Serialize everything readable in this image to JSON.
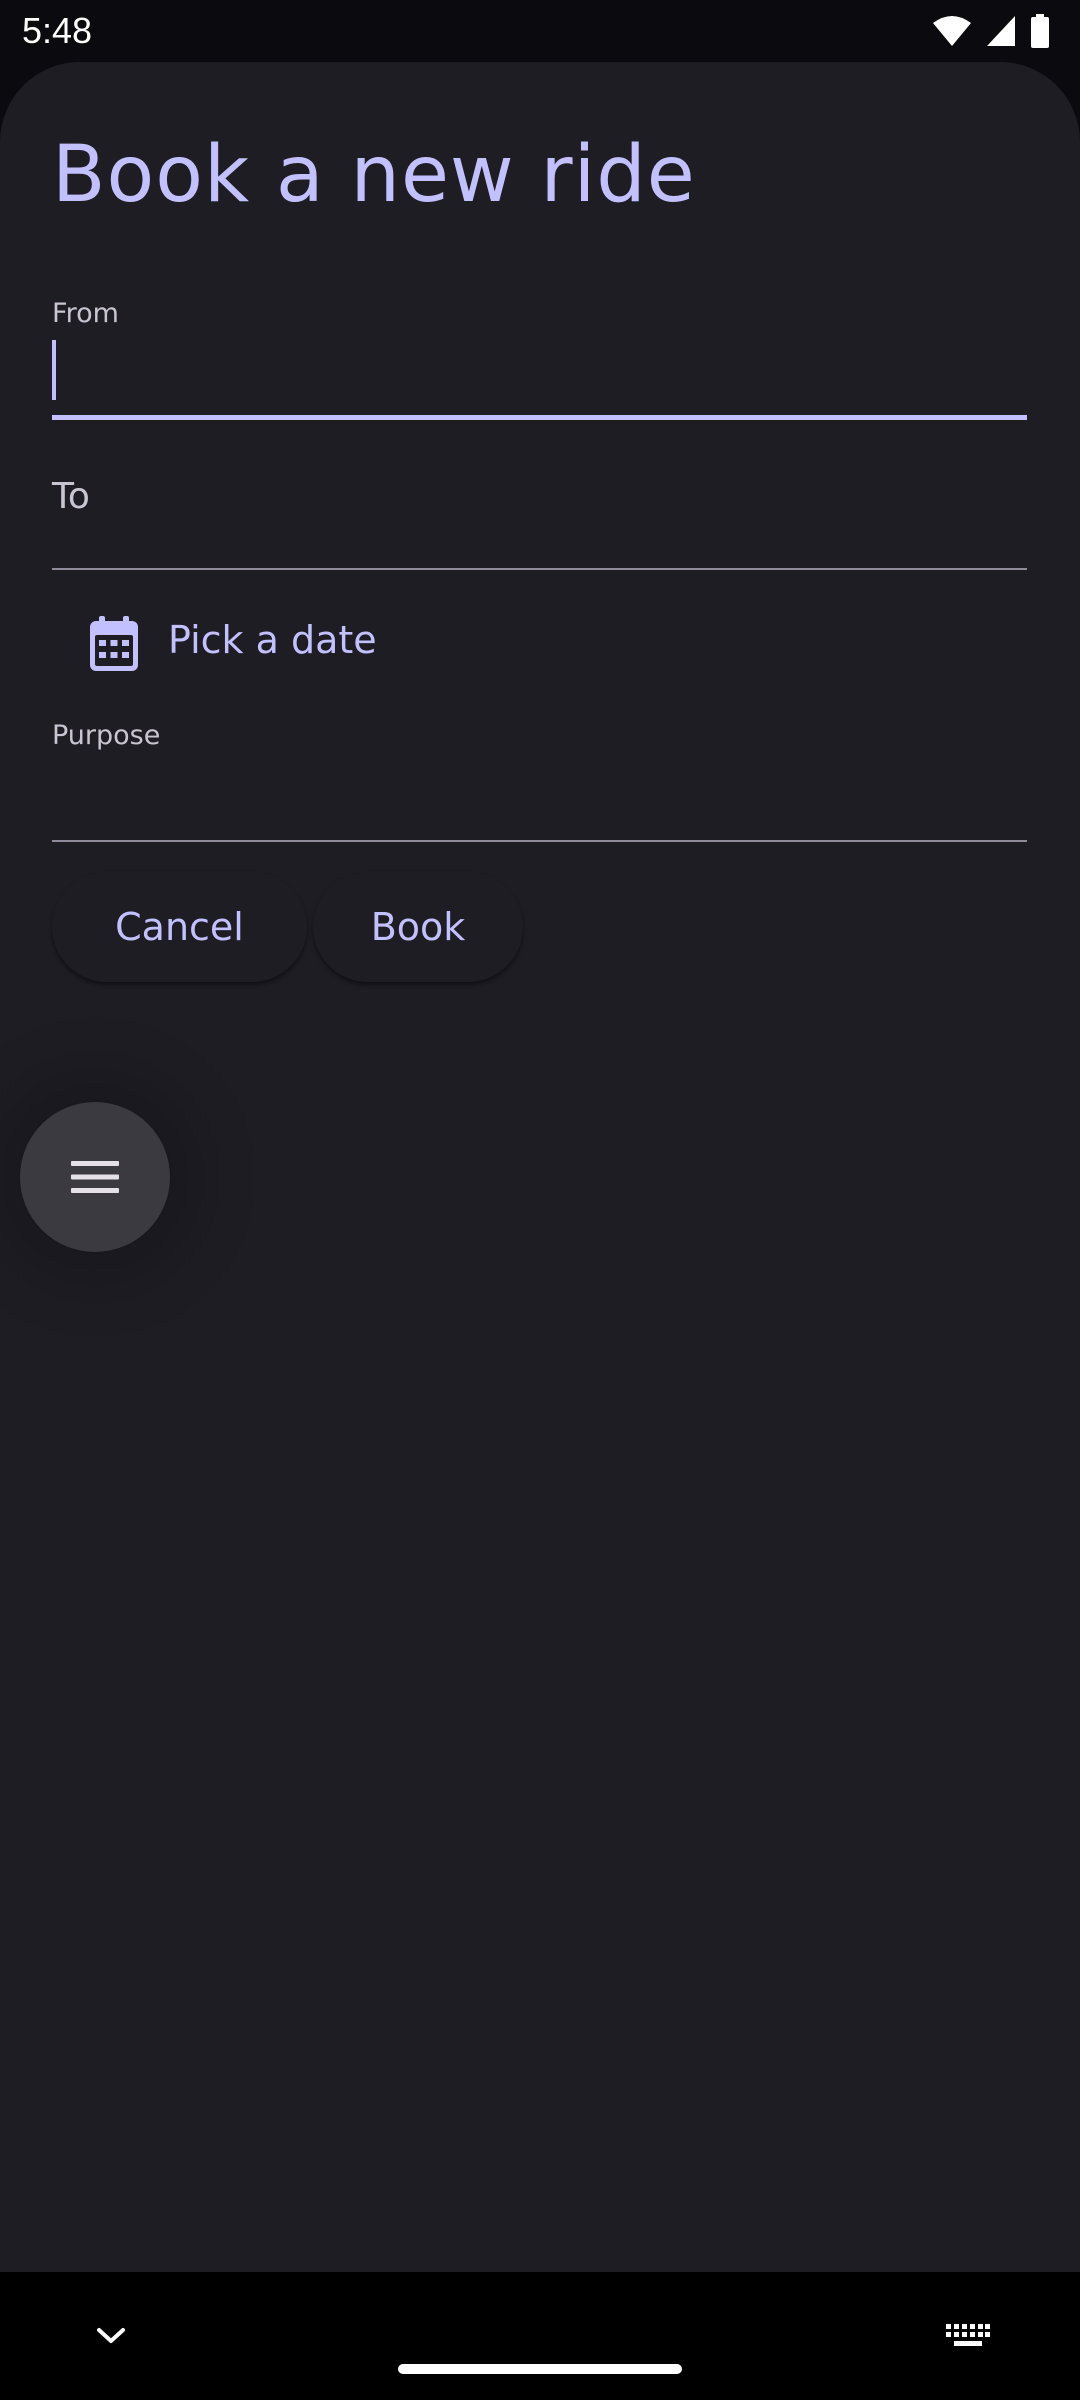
{
  "status_bar": {
    "time": "5:48",
    "icons": [
      "wifi-icon",
      "cellular-signal-icon",
      "battery-icon"
    ]
  },
  "form": {
    "title": "Book a new ride",
    "from": {
      "label": "From",
      "value": ""
    },
    "to": {
      "label": "To",
      "value": ""
    },
    "date": {
      "label": "Pick a date",
      "icon": "calendar-icon"
    },
    "purpose": {
      "label": "Purpose",
      "value": ""
    },
    "actions": {
      "cancel": "Cancel",
      "book": "Book"
    }
  },
  "fab": {
    "icon": "menu-icon"
  },
  "nav_bar": {
    "left_icon": "chevron-down-icon",
    "right_icon": "keyboard-icon"
  },
  "colors": {
    "accent": "#c3c0ff",
    "surface": "#1e1d24",
    "fab": "#3b3a41",
    "label": "#c9c5d0",
    "underline": "#8e8a96"
  }
}
